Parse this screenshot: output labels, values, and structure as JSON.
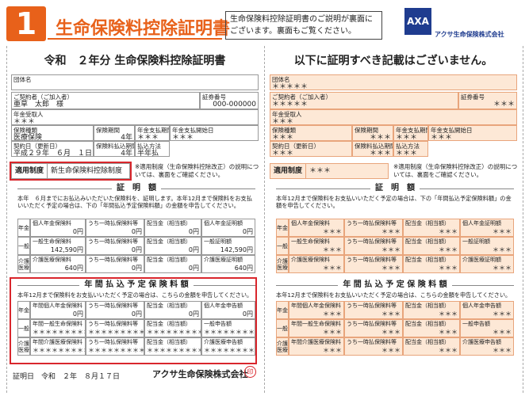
{
  "header": {
    "badge": "1",
    "title": "生命保険料控除証明書",
    "note": "生命保険料控除証明書のご説明が裏面にございます。裏面もご覧ください。",
    "company": "アクサ生命保険株式会社",
    "logo_text": "AXA",
    "brand_color": "#1f3c8f",
    "accent_color": "#e8611a"
  },
  "left": {
    "title": "令和　２年分 生命保険料控除証明書",
    "group": {
      "label": "団体名",
      "value": ""
    },
    "policyholder": {
      "label": "ご契約者（ご加入者）",
      "value": "亜草　太郎　様"
    },
    "policy_no": {
      "label": "証券番号",
      "value": "000-000000"
    },
    "annuitant": {
      "label": "年金受取人",
      "value": "＊＊＊"
    },
    "type": {
      "label": "保険種類",
      "value": "医療保険"
    },
    "period": {
      "label": "保険期間",
      "value": "4年"
    },
    "pay_period": {
      "label": "年金支払期間",
      "value": "＊＊＊"
    },
    "pay_start": {
      "label": "年金支払開始日",
      "value": "＊＊＊"
    },
    "contract_date": {
      "label": "契約日（更新日）",
      "value": "平成２９年　６月　１日"
    },
    "premium_period": {
      "label": "保険料払込期間",
      "value": "4年"
    },
    "pay_method": {
      "label": "払込方法",
      "value": "半年払"
    },
    "system": {
      "label": "適用制度",
      "value": "新生命保険料控除制度"
    },
    "system_note": "※適用制度（生命保険料控除改正）の説明については、裏面をご確認ください。",
    "proof_heading": "証　明　額",
    "proof_text": "本年　６月までにお払込みいただいた保険料を、証明します。本年12月まで保険料をお支払いいただく予定の場合は、下の「年間払込予定保険料額」の金額を申告してください。",
    "proof_rows": [
      {
        "label": "年金",
        "cells": [
          {
            "label": "個人年金保険料",
            "value": "0円"
          },
          {
            "label": "うち一時払保険料等",
            "value": "0円"
          },
          {
            "label": "配当金（相当額）",
            "value": "0円"
          },
          {
            "label": "個人年金証明額",
            "value": "0円"
          }
        ]
      },
      {
        "label": "一般",
        "cells": [
          {
            "label": "一般生命保険料",
            "value": "142,590円"
          },
          {
            "label": "うち一時払保険料等",
            "value": "0円"
          },
          {
            "label": "配当金（相当額）",
            "value": "0円"
          },
          {
            "label": "一般証明額",
            "value": "142,590円"
          }
        ]
      },
      {
        "label": "介護医療",
        "cells": [
          {
            "label": "介護医療保険料",
            "value": "640円"
          },
          {
            "label": "うち一時払保険料等",
            "value": "0円"
          },
          {
            "label": "配当金（相当額）",
            "value": "0円"
          },
          {
            "label": "介護医療証明額",
            "value": "640円"
          }
        ]
      }
    ],
    "annual_heading": "年 間 払 込 予 定 保 険 料 額",
    "annual_text": "本年12月まで保険料をお支払いいただく予定の場合は、こちらの金額を申告してください。",
    "annual_rows": [
      {
        "label": "年金",
        "cells": [
          {
            "label": "年間個人年金保険料",
            "value": "0円"
          },
          {
            "label": "うち一時払保険料等",
            "value": "0円"
          },
          {
            "label": "配当金（相当額）",
            "value": "0円"
          },
          {
            "label": "個人年金申告額",
            "value": "0円"
          }
        ]
      },
      {
        "label": "一般",
        "cells": [
          {
            "label": "年間一般生命保険料",
            "value": "＊＊＊＊＊＊＊＊＊円"
          },
          {
            "label": "うち一時払保険料等",
            "value": "＊＊＊＊＊＊＊＊＊円"
          },
          {
            "label": "配当金（相当額）",
            "value": "＊＊＊＊＊＊＊＊＊円"
          },
          {
            "label": "一般申告額",
            "value": "＊＊＊＊＊＊＊＊＊円"
          }
        ]
      },
      {
        "label": "介護医療",
        "cells": [
          {
            "label": "年間介護医療保険料",
            "value": "＊＊＊＊＊＊＊＊＊円"
          },
          {
            "label": "うち一時払保険料等",
            "value": "＊＊＊＊＊＊＊＊＊円"
          },
          {
            "label": "配当金（相当額）",
            "value": "＊＊＊＊＊＊＊＊＊円"
          },
          {
            "label": "介護医療申告額",
            "value": "＊＊＊＊＊＊＊＊＊円"
          }
        ]
      }
    ],
    "footer_label": "証明日",
    "footer_date": "令和　２年　８月１７日",
    "footer_company": "アクサ生命保険株式会社",
    "seal": "印"
  },
  "right": {
    "title": "以下に証明すべき記載はございません。",
    "group": {
      "label": "団体名",
      "value": "＊＊＊＊＊"
    },
    "policyholder": {
      "label": "ご契約者（ご加入者）",
      "value": "＊＊＊＊＊"
    },
    "policy_no": {
      "label": "証券番号",
      "value": "＊＊＊"
    },
    "annuitant": {
      "label": "年金受取人",
      "value": "＊＊＊"
    },
    "type": {
      "label": "保険種類",
      "value": "＊＊＊"
    },
    "period": {
      "label": "保険期間",
      "value": "＊＊＊"
    },
    "pay_period": {
      "label": "年金支払期間",
      "value": "＊＊＊"
    },
    "pay_start": {
      "label": "年金支払開始日",
      "value": "＊＊＊"
    },
    "contract_date": {
      "label": "契約日（更新日）",
      "value": "＊＊＊"
    },
    "premium_period": {
      "label": "保険料払込期間",
      "value": "＊＊＊"
    },
    "pay_method": {
      "label": "払込方法",
      "value": "＊＊＊"
    },
    "system": {
      "label": "適用制度",
      "value": "＊＊＊"
    },
    "system_note": "※適用制度（生命保険料控除改正）の説明については、裏面をご確認ください。",
    "proof_heading": "証　明　額",
    "proof_text": "本年12月まで保険料をお支払いいただく予定の場合は、下の「年間払込予定保険料額」の金額を申告してください。",
    "proof_rows": [
      {
        "label": "年金",
        "cells": [
          {
            "label": "個人年金保険料",
            "value": "＊＊＊"
          },
          {
            "label": "うち一時払保険料等",
            "value": "＊＊＊"
          },
          {
            "label": "配当金（相当額）",
            "value": "＊＊＊"
          },
          {
            "label": "個人年金証明額",
            "value": "＊＊＊"
          }
        ]
      },
      {
        "label": "一般",
        "cells": [
          {
            "label": "一般生命保険料",
            "value": "＊＊＊"
          },
          {
            "label": "うち一時払保険料等",
            "value": "＊＊＊"
          },
          {
            "label": "配当金（相当額）",
            "value": "＊＊＊"
          },
          {
            "label": "一般証明額",
            "value": "＊＊＊"
          }
        ]
      },
      {
        "label": "介護医療",
        "cells": [
          {
            "label": "介護医療保険料",
            "value": "＊＊＊"
          },
          {
            "label": "うち一時払保険料等",
            "value": "＊＊＊"
          },
          {
            "label": "配当金（相当額）",
            "value": "＊＊＊"
          },
          {
            "label": "介護医療証明額",
            "value": "＊＊＊"
          }
        ]
      }
    ],
    "annual_heading": "年 間 払 込 予 定 保 険 料 額",
    "annual_text": "本年12月まで保険料をお支払いいただく予定の場合は、こちらの金額を申告してください。",
    "annual_rows": [
      {
        "label": "年金",
        "cells": [
          {
            "label": "年間個人年金保険料",
            "value": "＊＊＊"
          },
          {
            "label": "うち一時払保険料等",
            "value": "＊＊＊"
          },
          {
            "label": "配当金（相当額）",
            "value": "＊＊＊"
          },
          {
            "label": "個人年金申告額",
            "value": "＊＊＊"
          }
        ]
      },
      {
        "label": "一般",
        "cells": [
          {
            "label": "年間一般生命保険料",
            "value": "＊＊＊"
          },
          {
            "label": "うち一時払保険料等",
            "value": "＊＊＊"
          },
          {
            "label": "配当金（相当額）",
            "value": "＊＊＊"
          },
          {
            "label": "一般申告額",
            "value": "＊＊＊"
          }
        ]
      },
      {
        "label": "介護医療",
        "cells": [
          {
            "label": "年間介護医療保険料",
            "value": "＊＊＊"
          },
          {
            "label": "うち一時払保険料等",
            "value": "＊＊＊"
          },
          {
            "label": "配当金（相当額）",
            "value": "＊＊＊"
          },
          {
            "label": "介護医療申告額",
            "value": "＊＊＊"
          }
        ]
      }
    ]
  }
}
